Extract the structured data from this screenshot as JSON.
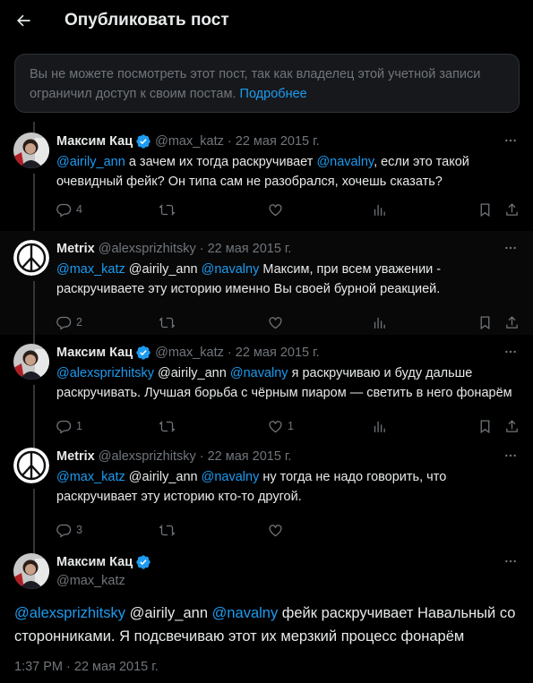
{
  "header": {
    "title": "Опубликовать пост"
  },
  "notice": {
    "text": "Вы не можете посмотреть этот пост, так как владелец этой учетной записи ограничил доступ к своим постам.",
    "link": "Подробнее"
  },
  "tweets": [
    {
      "name": "Максим Кац",
      "verified": true,
      "handle": "@max_katz",
      "date": "22 мая 2015 г.",
      "parts": [
        [
          "m",
          "@airily_ann"
        ],
        [
          "t",
          " а зачем их тогда раскручивает "
        ],
        [
          "m",
          "@navalny"
        ],
        [
          "t",
          ", если это такой очевидный фейк? Он типа сам не разобрался, хочешь сказать?"
        ]
      ],
      "replies": "4",
      "retweets": "",
      "likes": "",
      "views": ""
    },
    {
      "name": "Metrix",
      "verified": false,
      "handle": "@alexsprizhitsky",
      "date": "22 мая 2015 г.",
      "parts": [
        [
          "m",
          "@max_katz"
        ],
        [
          "t",
          " @airily_ann "
        ],
        [
          "m",
          "@navalny"
        ],
        [
          "t",
          " Максим, при всем уважении - раскручиваете эту историю именно Вы своей бурной реакцией."
        ]
      ],
      "replies": "2",
      "retweets": "",
      "likes": "",
      "views": ""
    },
    {
      "name": "Максим Кац",
      "verified": true,
      "handle": "@max_katz",
      "date": "22 мая 2015 г.",
      "parts": [
        [
          "m",
          "@alexsprizhitsky"
        ],
        [
          "t",
          " @airily_ann "
        ],
        [
          "m",
          "@navalny"
        ],
        [
          "t",
          " я раскручиваю и буду дальше раскручивать. Лучшая борьба с чёрным пиаром — светить в него фонарём"
        ]
      ],
      "replies": "1",
      "retweets": "",
      "likes": "1",
      "views": ""
    },
    {
      "name": "Metrix",
      "verified": false,
      "handle": "@alexsprizhitsky",
      "date": "22 мая 2015 г.",
      "parts": [
        [
          "m",
          "@max_katz"
        ],
        [
          "t",
          " @airily_ann "
        ],
        [
          "m",
          "@navalny"
        ],
        [
          "t",
          " ну тогда не надо говорить, что раскручивает эту историю кто-то другой."
        ]
      ],
      "replies": "3",
      "retweets": "",
      "likes": "",
      "views": ""
    }
  ],
  "main": {
    "name": "Максим Кац",
    "verified": true,
    "handle": "@max_katz",
    "parts": [
      [
        "m",
        "@alexsprizhitsky"
      ],
      [
        "t",
        " @airily_ann "
      ],
      [
        "m",
        "@navalny"
      ],
      [
        "t",
        " фейк раскручивает Навальный со сторонниками. Я подсвечиваю этот их мерзкий процесс фонарём"
      ]
    ],
    "time": "1:37 PM · 22 мая 2015 г."
  },
  "colors": {
    "accent": "#1d9bf0",
    "muted": "#71767b",
    "text": "#e7e9ea",
    "border": "#2f3336"
  },
  "icons": [
    "back-arrow-icon",
    "verified-badge-icon",
    "more-icon",
    "reply-icon",
    "retweet-icon",
    "like-icon",
    "views-icon",
    "bookmark-icon",
    "share-icon"
  ]
}
